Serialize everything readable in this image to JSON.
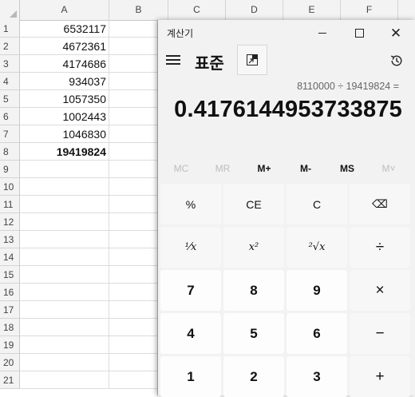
{
  "sheet": {
    "columns": [
      "A",
      "B",
      "C",
      "D",
      "E",
      "F"
    ],
    "rows": [
      {
        "num": "1",
        "a": "6532117",
        "bold": false
      },
      {
        "num": "2",
        "a": "4672361",
        "bold": false
      },
      {
        "num": "3",
        "a": "4174686",
        "bold": false
      },
      {
        "num": "4",
        "a": "934037",
        "bold": false
      },
      {
        "num": "5",
        "a": "1057350",
        "bold": false
      },
      {
        "num": "6",
        "a": "1002443",
        "bold": false
      },
      {
        "num": "7",
        "a": "1046830",
        "bold": false
      },
      {
        "num": "8",
        "a": "19419824",
        "bold": true
      },
      {
        "num": "9",
        "a": "",
        "bold": false
      },
      {
        "num": "10",
        "a": "",
        "bold": false
      },
      {
        "num": "11",
        "a": "",
        "bold": false
      },
      {
        "num": "12",
        "a": "",
        "bold": false
      },
      {
        "num": "13",
        "a": "",
        "bold": false
      },
      {
        "num": "14",
        "a": "",
        "bold": false
      },
      {
        "num": "15",
        "a": "",
        "bold": false
      },
      {
        "num": "16",
        "a": "",
        "bold": false
      },
      {
        "num": "17",
        "a": "",
        "bold": false
      },
      {
        "num": "18",
        "a": "",
        "bold": false
      },
      {
        "num": "19",
        "a": "",
        "bold": false
      },
      {
        "num": "20",
        "a": "",
        "bold": false
      },
      {
        "num": "21",
        "a": "",
        "bold": false
      }
    ]
  },
  "calculator": {
    "window_title": "계산기",
    "mode": "표준",
    "expression": "8110000 ÷ 19419824 =",
    "result": "0.4176144953733875",
    "memory_buttons": [
      {
        "label": "MC",
        "enabled": false
      },
      {
        "label": "MR",
        "enabled": false
      },
      {
        "label": "M+",
        "enabled": true
      },
      {
        "label": "M-",
        "enabled": true
      },
      {
        "label": "MS",
        "enabled": true
      },
      {
        "label": "M˅",
        "enabled": false
      }
    ],
    "keys": [
      {
        "label": "%",
        "name": "percent",
        "style": "op"
      },
      {
        "label": "CE",
        "name": "clear-entry",
        "style": "op"
      },
      {
        "label": "C",
        "name": "clear",
        "style": "op"
      },
      {
        "label": "⌫",
        "name": "backspace",
        "style": "op"
      },
      {
        "label": "¹⁄x",
        "name": "reciprocal",
        "style": "op-math"
      },
      {
        "label": "x²",
        "name": "square",
        "style": "op-math"
      },
      {
        "label": "²√x",
        "name": "square-root",
        "style": "op-math"
      },
      {
        "label": "÷",
        "name": "divide",
        "style": "op-glyph"
      },
      {
        "label": "7",
        "name": "digit-7",
        "style": "num"
      },
      {
        "label": "8",
        "name": "digit-8",
        "style": "num"
      },
      {
        "label": "9",
        "name": "digit-9",
        "style": "num"
      },
      {
        "label": "×",
        "name": "multiply",
        "style": "op-glyph"
      },
      {
        "label": "4",
        "name": "digit-4",
        "style": "num"
      },
      {
        "label": "5",
        "name": "digit-5",
        "style": "num"
      },
      {
        "label": "6",
        "name": "digit-6",
        "style": "num"
      },
      {
        "label": "−",
        "name": "subtract",
        "style": "op-glyph"
      },
      {
        "label": "1",
        "name": "digit-1",
        "style": "num"
      },
      {
        "label": "2",
        "name": "digit-2",
        "style": "num"
      },
      {
        "label": "3",
        "name": "digit-3",
        "style": "num"
      },
      {
        "label": "+",
        "name": "add",
        "style": "op-glyph"
      }
    ]
  }
}
